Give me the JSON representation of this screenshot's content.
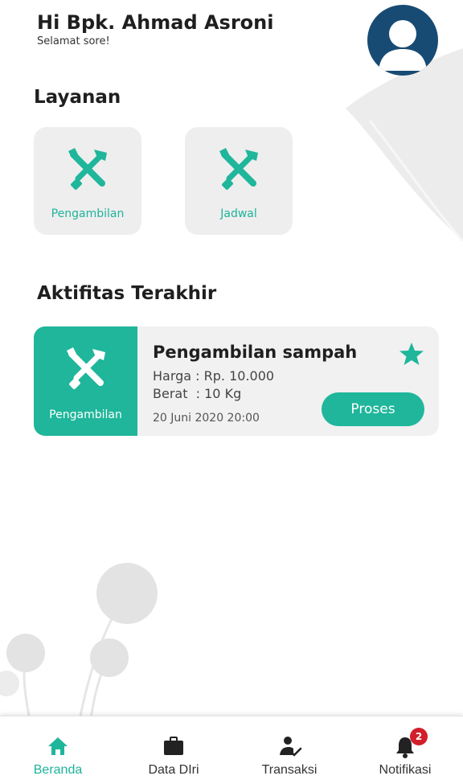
{
  "header": {
    "greeting": "Hi Bpk. Ahmad Asroni",
    "subtitle": "Selamat sore!"
  },
  "sections": {
    "services_title": "Layanan",
    "activity_title": "Aktifitas Terakhir"
  },
  "services": [
    {
      "label": "Pengambilan",
      "icon": "tools-icon"
    },
    {
      "label": "Jadwal",
      "icon": "tools-icon"
    }
  ],
  "activity": {
    "category": "Pengambilan",
    "title": "Pengambilan sampah",
    "price": "Harga : Rp. 10.000",
    "weight": "Berat  : 10 Kg",
    "date": "20 Juni 2020 20:00",
    "status_button": "Proses",
    "favorite_icon": "star-icon"
  },
  "bottom_nav": [
    {
      "label": "Beranda",
      "icon": "home-icon",
      "active": true
    },
    {
      "label": "Data DIri",
      "icon": "briefcase-icon",
      "active": false
    },
    {
      "label": "Transaksi",
      "icon": "user-check-icon",
      "active": false
    },
    {
      "label": "Notifikasi",
      "icon": "bell-icon",
      "active": false,
      "badge": "2"
    }
  ],
  "colors": {
    "accent": "#1fb69b",
    "avatar_bg": "#174b74",
    "card_bg": "#f1f1f1",
    "badge": "#d21f2b"
  }
}
